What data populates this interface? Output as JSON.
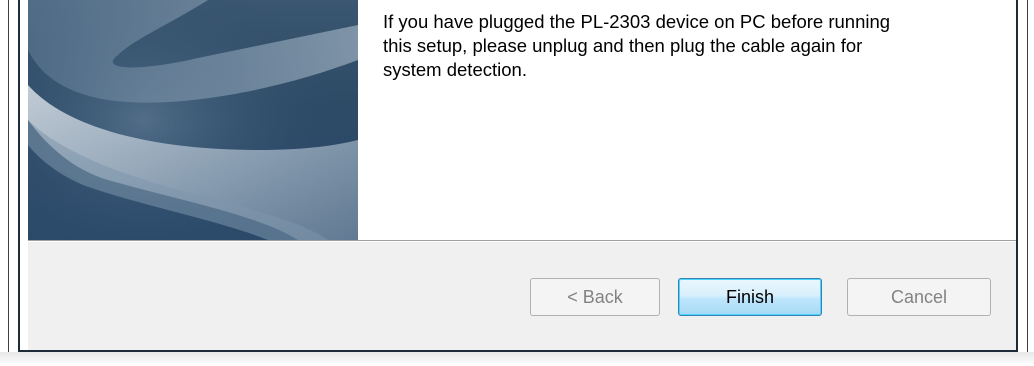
{
  "message": {
    "lines": [
      "If you have plugged the PL-2303 device on PC before running",
      "this setup, please unplug and then plug the cable again for",
      "system detection."
    ]
  },
  "buttons": {
    "back_label": "< Back",
    "finish_label": "Finish",
    "cancel_label": "Cancel"
  },
  "colors": {
    "side_panel": "#2d4a66",
    "button_bar": "#f0f0f0",
    "default_button_border": "#3c7fb1"
  },
  "states": {
    "back_enabled": false,
    "finish_enabled": true,
    "cancel_enabled": false
  }
}
